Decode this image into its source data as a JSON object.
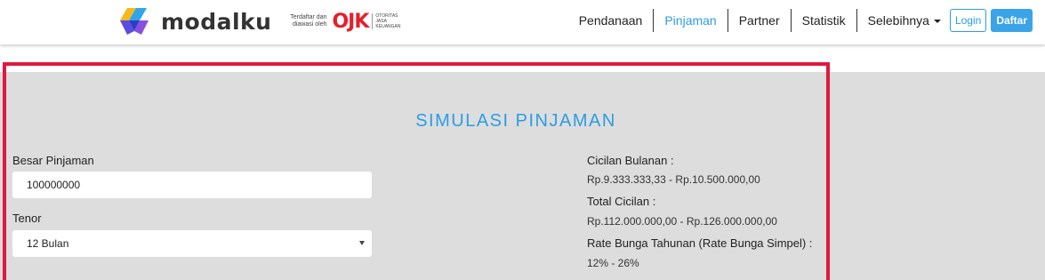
{
  "header": {
    "brand": "modalku",
    "ojk_text": "Terdaftar dan diawasi oleh",
    "ojk_mark": "OJK",
    "ojk_sub": "OTORITAS JASA KEUANGAN"
  },
  "nav": {
    "items": [
      "Pendanaan",
      "Pinjaman",
      "Partner",
      "Statistik",
      "Selebihnya"
    ],
    "login": "Login",
    "daftar": "Daftar",
    "active": "Pinjaman"
  },
  "simulation": {
    "title": "SIMULASI PINJAMAN",
    "amount_label": "Besar Pinjaman",
    "amount_value": "100000000",
    "tenor_label": "Tenor",
    "tenor_value": "12 Bulan",
    "monthly_label": "Cicilan Bulanan :",
    "monthly_value": "Rp.9.333.333,33 - Rp.10.500.000,00",
    "total_label": "Total Cicilan :",
    "total_value": "Rp.112.000.000,00 - Rp.126.000.000,00",
    "rate_label": "Rate Bunga Tahunan (Rate Bunga Simpel) :",
    "rate_value": "12% - 26%"
  },
  "colors": {
    "accent": "#2b9de4",
    "highlight": "#e0193f",
    "background": "#dddddd"
  }
}
